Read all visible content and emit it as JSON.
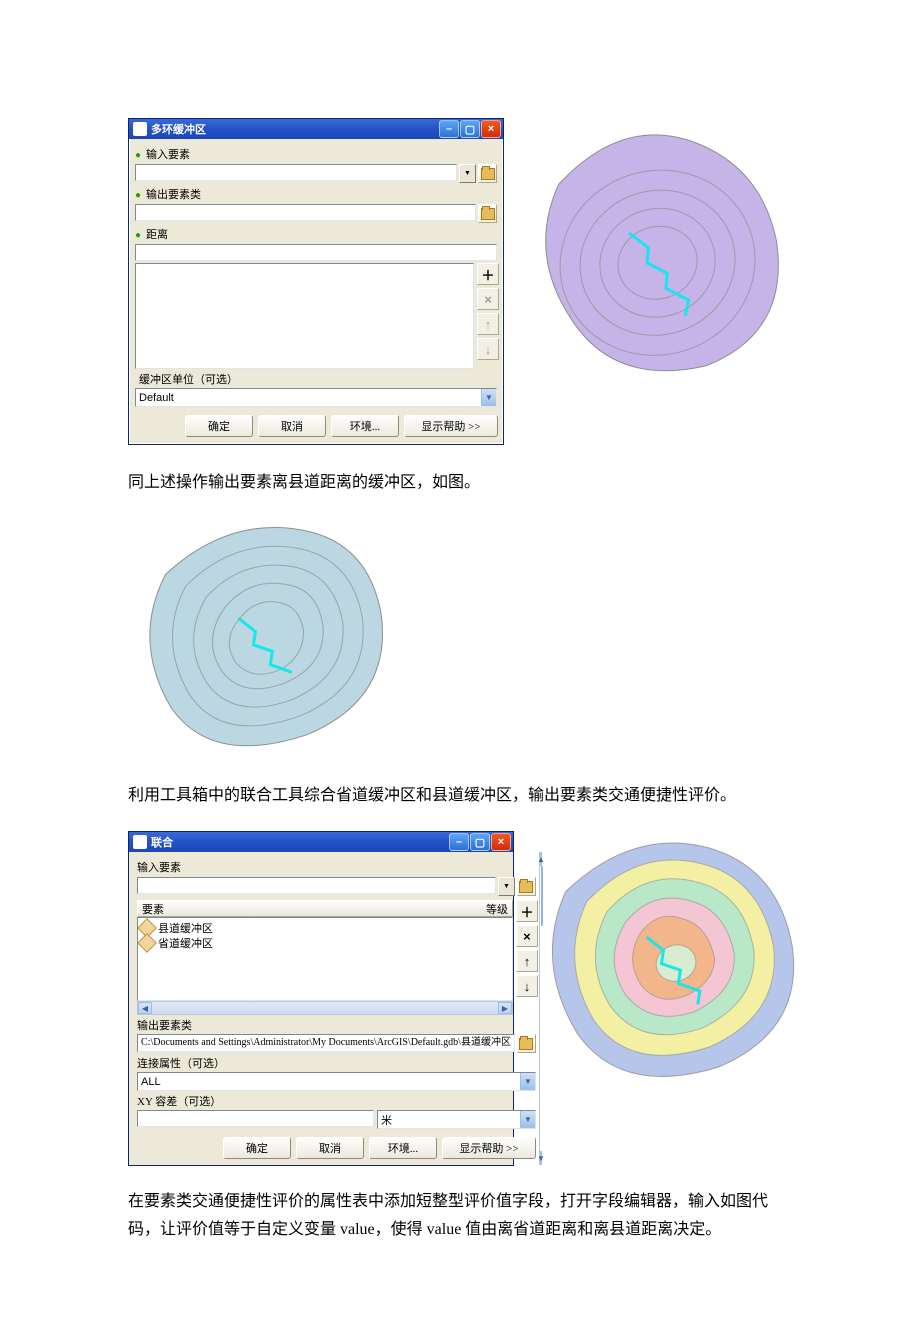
{
  "dialog1": {
    "title": "多环缓冲区",
    "labels": {
      "input_features": "输入要素",
      "output_features": "输出要素类",
      "distance": "距离",
      "buffer_unit": "缓冲区单位（可选）"
    },
    "unit_value": "Default",
    "buttons": {
      "plus": "＋",
      "x": "×",
      "up": "↑",
      "down": "↓",
      "ok": "确定",
      "cancel": "取消",
      "env": "环境...",
      "help": "显示帮助 >>"
    }
  },
  "para1": "同上述操作输出要素离县道距离的缓冲区，如图。",
  "para2": "利用工具箱中的联合工具综合省道缓冲区和县道缓冲区，输出要素类交通便捷性评价。",
  "dialog2": {
    "title": "联合",
    "labels": {
      "input_features": "输入要素",
      "feature_col": "要素",
      "rank_col": "等级",
      "output_features": "输出要素类",
      "join_attr": "连接属性（可选）",
      "xy_tol": "XY 容差（可选）"
    },
    "items": [
      "县道缓冲区",
      "省道缓冲区"
    ],
    "output_path": "C:\\Documents and Settings\\Administrator\\My Documents\\ArcGIS\\Default.gdb\\县道缓冲区",
    "join_value": "ALL",
    "xy_unit": "米",
    "buttons": {
      "plus": "＋",
      "x": "×",
      "up": "↑",
      "down": "↓",
      "ok": "确定",
      "cancel": "取消",
      "env": "环境...",
      "help": "显示帮助 >>"
    }
  },
  "para3": "在要素类交通便捷性评价的属性表中添加短整型评价值字段，打开字段编辑器，输入如图代码，让评价值等于自定义变量 value，使得 value 值由离省道距离和离县道距离决定。"
}
